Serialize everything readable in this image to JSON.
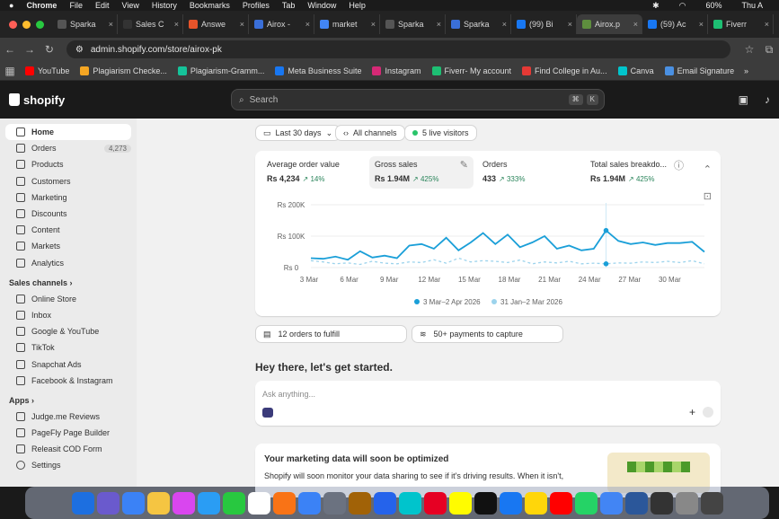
{
  "menubar": {
    "app": "Chrome",
    "items": [
      "File",
      "Edit",
      "View",
      "History",
      "Bookmarks",
      "Profiles",
      "Tab",
      "Window",
      "Help"
    ],
    "battery": "60%",
    "clock": "Thu A"
  },
  "tabs": [
    {
      "label": "Sparka",
      "color": "#555"
    },
    {
      "label": "Sales C",
      "color": "#333"
    },
    {
      "label": "Answe",
      "color": "#e8542a"
    },
    {
      "label": "Airox -",
      "color": "#3a6fd8"
    },
    {
      "label": "market",
      "color": "#4285f4"
    },
    {
      "label": "Sparka",
      "color": "#555"
    },
    {
      "label": "Sparka",
      "color": "#3a6fd8"
    },
    {
      "label": "(99) Bi",
      "color": "#1877f2"
    },
    {
      "label": "Airox.p",
      "color": "#5e8e3e",
      "active": true
    },
    {
      "label": "(59) Ac",
      "color": "#1877f2"
    },
    {
      "label": "Fiverr",
      "color": "#1dbf73"
    }
  ],
  "address": "admin.shopify.com/store/airox-pk",
  "bookmarks": [
    {
      "label": "YouTube",
      "color": "#ff0000"
    },
    {
      "label": "Plagiarism Checke...",
      "color": "#f5a623"
    },
    {
      "label": "Plagiarism-Gramm...",
      "color": "#15c39a"
    },
    {
      "label": "Meta Business Suite",
      "color": "#1877f2"
    },
    {
      "label": "Instagram",
      "color": "#d62976"
    },
    {
      "label": "Fiverr- My account",
      "color": "#1dbf73"
    },
    {
      "label": "Find College in Au...",
      "color": "#e53935"
    },
    {
      "label": "Canva",
      "color": "#00c4cc"
    },
    {
      "label": "Email Signature",
      "color": "#4a90e2"
    }
  ],
  "brand": "shopify",
  "search": {
    "placeholder": "Search",
    "k1": "⌘",
    "k2": "K"
  },
  "sidebar": {
    "items": [
      {
        "label": "Home",
        "active": true
      },
      {
        "label": "Orders",
        "count": "4,273"
      },
      {
        "label": "Products"
      },
      {
        "label": "Customers"
      },
      {
        "label": "Marketing"
      },
      {
        "label": "Discounts"
      },
      {
        "label": "Content"
      },
      {
        "label": "Markets"
      },
      {
        "label": "Analytics"
      }
    ],
    "sales_channels": "Sales channels",
    "channels": [
      {
        "label": "Online Store"
      },
      {
        "label": "Inbox"
      },
      {
        "label": "Google & YouTube"
      },
      {
        "label": "TikTok"
      },
      {
        "label": "Snapchat Ads"
      },
      {
        "label": "Facebook & Instagram"
      }
    ],
    "apps_head": "Apps",
    "apps": [
      {
        "label": "Judge.me Reviews"
      },
      {
        "label": "PageFly Page Builder"
      },
      {
        "label": "Releasit COD Form"
      }
    ],
    "settings": "Settings"
  },
  "filters": {
    "range": "Last 30 days",
    "channels": "All channels",
    "live": "5 live visitors"
  },
  "metrics": [
    {
      "title": "Average order value",
      "value": "Rs 4,234",
      "delta": "14%"
    },
    {
      "title": "Gross sales",
      "value": "Rs 1.94M",
      "delta": "425%"
    },
    {
      "title": "Orders",
      "value": "433",
      "delta": "333%"
    },
    {
      "title": "Total sales breakdo...",
      "value": "Rs 1.94M",
      "delta": "425%"
    }
  ],
  "chart_data": {
    "type": "line",
    "y_ticks": [
      "Rs 200K",
      "Rs 100K",
      "Rs 0"
    ],
    "x_ticks": [
      "3 Mar",
      "6 Mar",
      "9 Mar",
      "12 Mar",
      "15 Mar",
      "18 Mar",
      "21 Mar",
      "24 Mar",
      "27 Mar",
      "30 Mar"
    ],
    "ylim": [
      0,
      200000
    ],
    "series": [
      {
        "name": "3 Mar–2 Apr 2026",
        "color": "#1a9fd8",
        "values": [
          30000,
          28000,
          35000,
          25000,
          52000,
          32000,
          38000,
          30000,
          70000,
          75000,
          60000,
          95000,
          55000,
          80000,
          110000,
          75000,
          105000,
          65000,
          80000,
          100000,
          60000,
          70000,
          55000,
          60000,
          118000,
          85000,
          75000,
          80000,
          72000,
          78000,
          78000,
          82000,
          50000
        ]
      },
      {
        "name": "31 Jan–2 Mar 2026",
        "color": "#9cd3ec",
        "dashed": true,
        "values": [
          22000,
          18000,
          12000,
          15000,
          10000,
          20000,
          14000,
          12000,
          18000,
          16000,
          25000,
          14000,
          30000,
          18000,
          22000,
          20000,
          16000,
          24000,
          12000,
          18000,
          15000,
          20000,
          12000,
          14000,
          12000,
          15000,
          14000,
          18000,
          16000,
          20000,
          16000,
          22000,
          12000
        ]
      }
    ]
  },
  "fulfill": "12 orders to fulfill",
  "payments": "50+ payments to capture",
  "greeting": "Hey there, let's get started.",
  "ask": "Ask anything...",
  "marketing": {
    "title": "Your marketing data will soon be optimized",
    "body": "Shopify will soon monitor your data sharing to see if it's driving results. When it isn't,"
  },
  "dock_colors": [
    "#1d6fe0",
    "#6a5acd",
    "#3b82f6",
    "#f5c542",
    "#d946ef",
    "#2a9df4",
    "#28c840",
    "#ffffff",
    "#f97316",
    "#3b82f6",
    "#6b7280",
    "#a16207",
    "#2563eb",
    "#00c4cc",
    "#e60023",
    "#fffc00",
    "#111111",
    "#1877f2",
    "#ffd60a",
    "#ff0000",
    "#25d366",
    "#4285f4",
    "#2b579a",
    "#333333",
    "#888888",
    "#444444"
  ]
}
